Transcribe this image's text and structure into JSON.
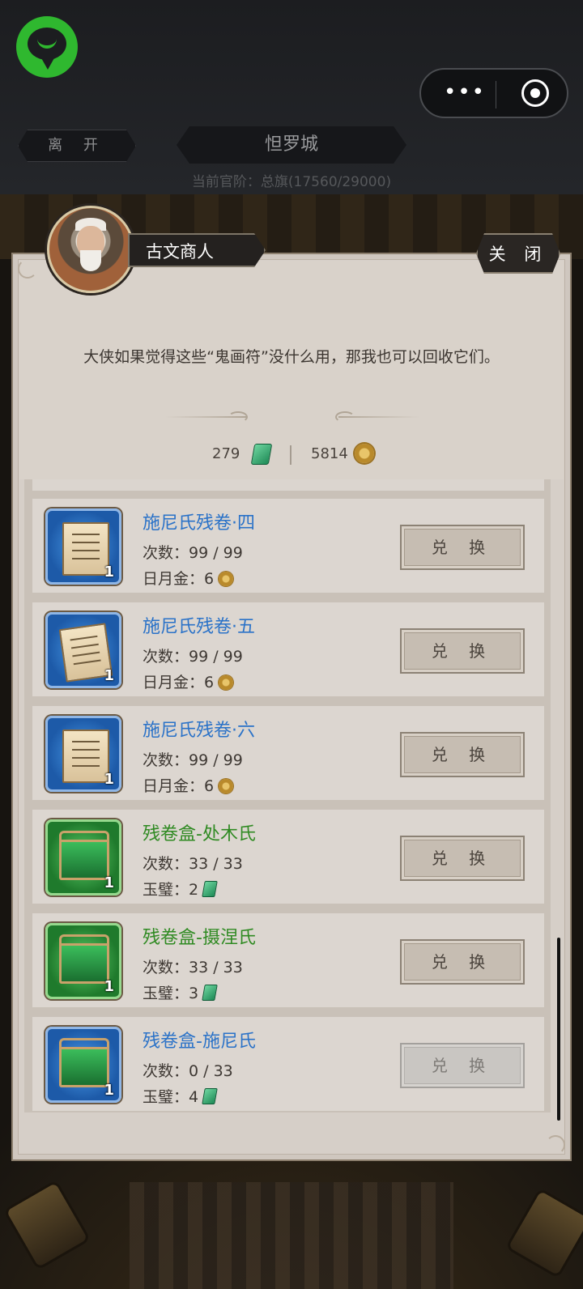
{
  "header": {
    "leave_label": "离 开",
    "city_name": "怛罗城",
    "rank_text": "当前官阶：总旗(17560/29000)"
  },
  "capsule": {
    "more_glyph": "•••"
  },
  "merchant": {
    "name": "古文商人",
    "close_label": "关 闭",
    "dialog": "大侠如果觉得这些“鬼画符”没什么用，那我也可以回收它们。"
  },
  "currency": {
    "jade": "279",
    "gold": "5814"
  },
  "items": [
    {
      "title": "施尼氏残卷·四",
      "count": "次数：99 / 99",
      "cost": "日月金：6",
      "qty": "1",
      "button": "兑 换"
    },
    {
      "title": "施尼氏残卷·五",
      "count": "次数：99 / 99",
      "cost": "日月金：6",
      "qty": "1",
      "button": "兑 换"
    },
    {
      "title": "施尼氏残卷·六",
      "count": "次数：99 / 99",
      "cost": "日月金：6",
      "qty": "1",
      "button": "兑 换"
    },
    {
      "title": "残卷盒-处木氏",
      "count": "次数：33 / 33",
      "cost": "玉璧：2",
      "qty": "1",
      "button": "兑 换"
    },
    {
      "title": "残卷盒-摄涅氏",
      "count": "次数：33 / 33",
      "cost": "玉璧：3",
      "qty": "1",
      "button": "兑 换"
    },
    {
      "title": "残卷盒-施尼氏",
      "count": "次数：0 / 33",
      "cost": "玉璧：4",
      "qty": "1",
      "button": "兑 换"
    }
  ],
  "colors": {
    "title_blue": "#2a72c8",
    "title_green": "#2f8a22",
    "wechat_green": "#2fb82f"
  }
}
